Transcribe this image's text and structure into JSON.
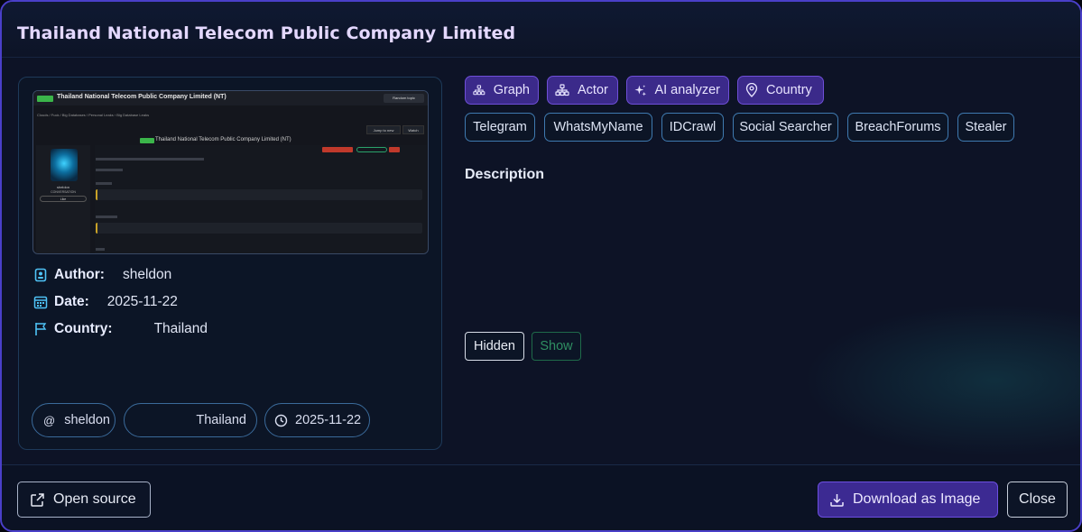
{
  "title": "Thailand National Telecom Public Company Limited",
  "screenshot": {
    "thread_title": "Thailand National Telecom Public Company Limited (NT)",
    "random_topic": "Random topic",
    "breadcrumb": "Clouds / Fuck / Big Databases / Personal Leaks › Big Database Leaks",
    "jump_label": "Jump to new",
    "watch_label": "Watch",
    "mid_title": "Thailand National Telecom Public Company Limited (NT)",
    "username": "sheldon",
    "conversation": "CONVERSATION",
    "like": "Like"
  },
  "meta": {
    "author_label": "Author:",
    "author_value": "sheldon",
    "date_label": "Date:",
    "date_value": "2025-11-22",
    "country_label": "Country:",
    "country_value": "Thailand"
  },
  "chips": {
    "author": "sheldon",
    "country": "Thailand",
    "date": "2025-11-22"
  },
  "actions": [
    {
      "label": "Graph",
      "icon": "graph-icon"
    },
    {
      "label": "Actor",
      "icon": "actor-icon"
    },
    {
      "label": "AI analyzer",
      "icon": "sparkle-icon"
    },
    {
      "label": "Country",
      "icon": "location-pin-icon"
    }
  ],
  "sources": [
    "Telegram",
    "WhatsMyName",
    "IDCrawl",
    "Social Searcher",
    "BreachForums",
    "Stealer"
  ],
  "description_heading": "Description",
  "toggle": {
    "hidden": "Hidden",
    "show": "Show"
  },
  "footer": {
    "open_source": "Open source",
    "download": "Download as Image",
    "close": "Close"
  },
  "colors": {
    "accent": "#3b2a8a",
    "accent_border": "#6f4fd8",
    "title": "#e4d8ff",
    "icon_cyan": "#4fc3f7"
  }
}
